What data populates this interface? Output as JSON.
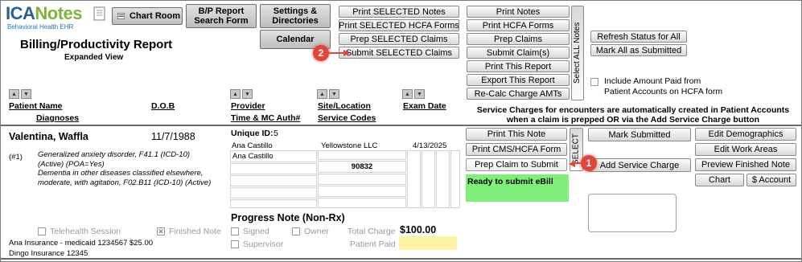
{
  "colors": {
    "accent_red": "#e0443a",
    "ready_green": "#7ef07a",
    "paid_yellow": "#fcf4a6",
    "logo_blue": "#2a78b5"
  },
  "logo": {
    "brand_ica": "ICA",
    "brand_notes": "Notes",
    "tagline": "Behavioral Health EHR"
  },
  "nav": {
    "chart_room": "Chart Room",
    "bp_report": "B/P Report Search Form",
    "settings": "Settings & Directories",
    "calendar": "Calendar"
  },
  "report": {
    "title": "Billing/Productivity Report",
    "subtitle": "Expanded View"
  },
  "toolbar": {
    "print_selected_notes": "Print SELECTED Notes",
    "print_selected_hcfa": "Print SELECTED HCFA Forms",
    "prep_selected_claims": "Prep SELECTED Claims",
    "submit_selected_claims": "Submit SELECTED Claims",
    "print_notes": "Print Notes",
    "print_hcfa": "Print HCFA Forms",
    "prep_claims": "Prep Claims",
    "submit_claims": "Submit Claim(s)",
    "print_report": "Print This Report",
    "export_report": "Export This Report",
    "recalc": "Re-Calc Charge AMTs",
    "select_all_notes": "Select ALL Notes",
    "refresh_status": "Refresh Status for All",
    "mark_all_submitted": "Mark All as Submitted",
    "include_amount_label": "Include Amount Paid from Patient Accounts on HCFA form",
    "service_charges_note": "Service Charges for encounters are automatically created in Patient Accounts when a claim is prepped OR via the Add Service Charge button"
  },
  "columns": {
    "patient_name": "Patient Name",
    "diagnoses": "Diagnoses",
    "dob": "D.O.B",
    "provider": "Provider",
    "time_mc": "Time & MC Auth#",
    "site": "Site/Location",
    "service_codes": "Service Codes",
    "exam_date": "Exam Date"
  },
  "record": {
    "patient_name": "Valentina, Waffla",
    "dob": "11/7/1988",
    "unique_id_label": "Unique ID:",
    "unique_id": "5",
    "provider": "Ana Castillo",
    "provider_field": "Ana Castillo",
    "site": "Yellowstone LLC",
    "exam_date": "4/13/2025",
    "service_code": "90832",
    "dx_num": "(#1)",
    "dx1_line1": "Generalized anxiety disorder, F41.1 (ICD-10)",
    "dx1_line2": "(Active) (POA=Yes)",
    "dx2_line1": "Dementia in other diseases classified elsewhere,",
    "dx2_line2": "moderate, with agitation, F02.B11 (ICD-10) (Active)",
    "telehealth": "Telehealth Session",
    "finished_note": "Finished Note",
    "progress_note": "Progress Note (Non-Rx)",
    "signed": "Signed",
    "owner": "Owner",
    "supervisor": "Supervisor",
    "total_charge_label": "Total Charge",
    "total_charge": "$100.00",
    "patient_paid_label": "Patient Paid",
    "patient_paid": "",
    "insurance1": "Ana Insurance - medicaid  1234567 $25.00",
    "insurance2": "Dingo Insurance  12345",
    "status_text": "Ready to submit eBill"
  },
  "row_actions": {
    "print_note": "Print This Note",
    "print_cms": "Print CMS/HCFA Form",
    "prep_claim": "Prep Claim to Submit",
    "select": "SELECT",
    "mark_submitted": "Mark Submitted",
    "add_service_charge": "Add Service Charge",
    "edit_demographics": "Edit Demographics",
    "edit_work_areas": "Edit Work Areas",
    "preview_note": "Preview Finished Note",
    "chart": "Chart",
    "account": "$ Account"
  },
  "annotations": {
    "badge1": "1",
    "badge2": "2"
  }
}
